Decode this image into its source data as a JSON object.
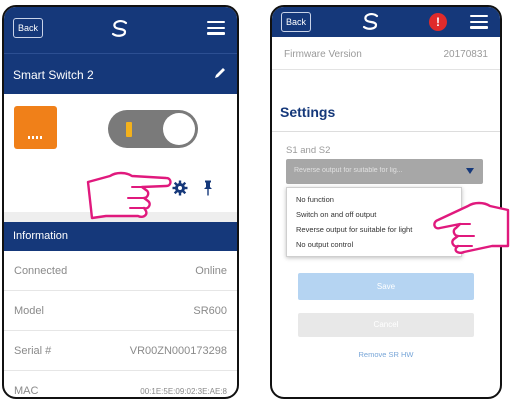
{
  "left_screen": {
    "header": {
      "back_label": "Back",
      "logo_icon": "s-logo-icon",
      "menu_icon": "hamburger-menu-icon"
    },
    "device": {
      "name": "Smart Switch 2",
      "edit_icon": "pencil-icon",
      "tile_color": "#f08019",
      "switch_state": "on"
    },
    "actions": {
      "settings_icon": "gear-icon",
      "pin_icon": "pin-icon"
    },
    "info": {
      "title": "Information",
      "rows": [
        {
          "label": "Connected",
          "value": "Online"
        },
        {
          "label": "Model",
          "value": "SR600"
        },
        {
          "label": "Serial #",
          "value": "VR00ZN000173298"
        },
        {
          "label": "MAC",
          "value": "00:1E:5E:09:02:3E:AE:8"
        }
      ]
    }
  },
  "right_screen": {
    "header": {
      "back_label": "Back",
      "logo_icon": "s-logo-icon",
      "alert_label": "!",
      "menu_icon": "hamburger-menu-icon"
    },
    "firmware": {
      "label": "Firmware Version",
      "value": "20170831"
    },
    "settings_title": "Settings",
    "s1s2": {
      "label": "S1 and S2",
      "selected": "Reverse output for suitable for lig...",
      "options": [
        "No function",
        "Switch on and off output",
        "Reverse output for suitable for light",
        "No output control"
      ]
    },
    "save_label": "Save",
    "cancel_label": "Cancel",
    "remove_label": "Remove SR HW"
  },
  "colors": {
    "header": "#15387a",
    "accent_orange": "#f08019",
    "hand_outline": "#e0197d",
    "alert": "#e02b2b",
    "save_button": "#b5d4f2"
  }
}
